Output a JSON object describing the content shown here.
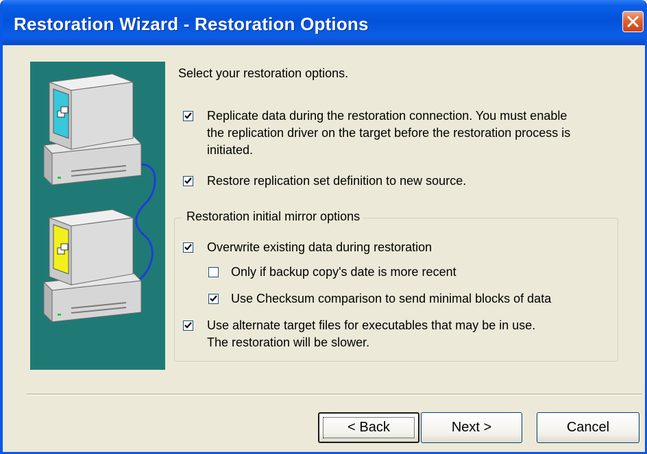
{
  "window": {
    "title": "Restoration Wizard - Restoration Options",
    "close_icon": "close-x-icon"
  },
  "artwork": {
    "description_icon": "two-networked-computers-illustration"
  },
  "main": {
    "intro": "Select your restoration options."
  },
  "options": {
    "replicate": {
      "checked": true,
      "line1": "Replicate data during the restoration connection. You must enable",
      "line2": "the replication driver on the target before the restoration process is",
      "line3": "initiated."
    },
    "restore_definition": {
      "checked": true,
      "label": "Restore replication set definition to new source."
    }
  },
  "mirror_group": {
    "legend": "Restoration initial mirror options",
    "overwrite": {
      "checked": true,
      "label": "Overwrite existing data during restoration"
    },
    "only_if_newer": {
      "checked": false,
      "label": "Only if backup copy's date is more recent"
    },
    "checksum": {
      "checked": true,
      "label": "Use Checksum comparison to send minimal blocks of data"
    },
    "alternate_files": {
      "checked": true,
      "line1": "Use alternate target files for executables that may be in use.",
      "line2": "The restoration will be slower."
    }
  },
  "buttons": {
    "back": "< Back",
    "next": "Next >",
    "cancel": "Cancel"
  },
  "colors": {
    "titlebar": "#0252d9",
    "artwork_background": "#1f7a75",
    "dialog_face": "#ece9d8",
    "checkbox_border": "#1c5180"
  }
}
